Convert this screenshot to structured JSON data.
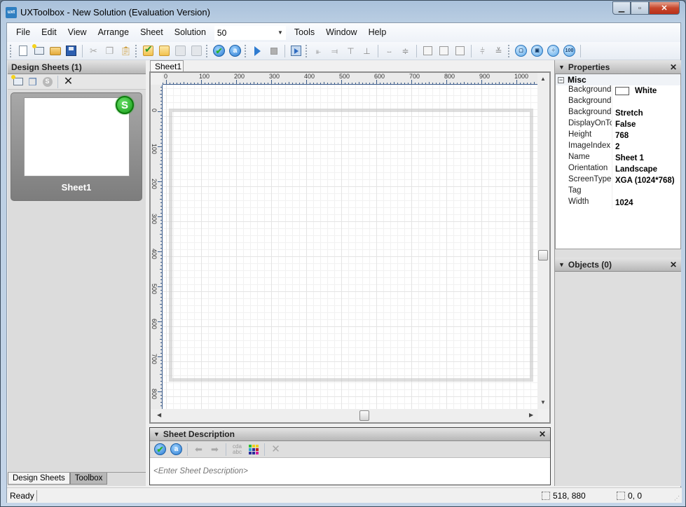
{
  "window": {
    "app_icon": "uxt",
    "title": "UXToolbox - New Solution (Evaluation Version)",
    "buttons": {
      "minimize": "minimize-icon",
      "maximize": "maximize-icon",
      "close": "close-icon"
    }
  },
  "menubar": {
    "items": [
      "File",
      "Edit",
      "View",
      "Arrange",
      "Sheet",
      "Solution"
    ],
    "zoom_value": "50",
    "items_after": [
      "Tools",
      "Window",
      "Help"
    ]
  },
  "toolbar": {
    "groups": [
      [
        "new-document",
        "new-sheet",
        "open-folder",
        "save"
      ],
      [
        "cut",
        "copy",
        "paste"
      ],
      [
        "sheet-checked",
        "sheet-blank",
        "sheet-back",
        "sheet-forward"
      ],
      [
        "validate",
        "annotate"
      ],
      [
        "run",
        "stop"
      ],
      [
        "preview"
      ],
      [
        "align-left",
        "align-right",
        "align-top",
        "align-bottom"
      ],
      [
        "center-horizontal",
        "center-vertical"
      ],
      [
        "same-size",
        "same-width",
        "same-height"
      ],
      [
        "space-horizontal",
        "space-vertical"
      ],
      [
        "fit-page",
        "zoom-region",
        "zoom-fit",
        "zoom-100"
      ]
    ],
    "zoom_100_label": "100"
  },
  "design_sheets": {
    "title": "Design Sheets (1)",
    "tools": [
      "new-sheet",
      "duplicate-sheet",
      "start-sheet",
      "delete-sheet"
    ],
    "sheets": [
      {
        "name": "Sheet1",
        "badge": "S"
      }
    ],
    "tabs": [
      "Design Sheets",
      "Toolbox"
    ],
    "active_tab": "Design Sheets"
  },
  "canvas": {
    "tab": "Sheet1",
    "hruler_labels": [
      "0",
      "100",
      "200",
      "300",
      "400",
      "500",
      "600",
      "700",
      "800",
      "900",
      "1000"
    ],
    "vruler_labels": [
      "0",
      "100",
      "200",
      "300",
      "400",
      "500",
      "600",
      "700",
      "800"
    ]
  },
  "sheet_description": {
    "title": "Sheet Description",
    "placeholder": "<Enter Sheet Description>",
    "tools": [
      "validate",
      "annotate",
      "back",
      "forward",
      "spell-check",
      "color-palette",
      "delete"
    ],
    "spell_label_top": "cda",
    "spell_label_bottom": "abc"
  },
  "properties": {
    "title": "Properties",
    "category": "Misc",
    "rows": [
      {
        "key": "BackgroundC",
        "value": "White",
        "swatch": "#ffffff"
      },
      {
        "key": "BackgroundIı",
        "value": ""
      },
      {
        "key": "BackgroundL",
        "value": "Stretch"
      },
      {
        "key": "DisplayOnTo",
        "value": "False"
      },
      {
        "key": "Height",
        "value": "768"
      },
      {
        "key": "ImageIndex",
        "value": "2"
      },
      {
        "key": "Name",
        "value": "Sheet 1"
      },
      {
        "key": "Orientation",
        "value": "Landscape"
      },
      {
        "key": "ScreenType",
        "value": "XGA (1024*768)"
      },
      {
        "key": "Tag",
        "value": ""
      },
      {
        "key": "Width",
        "value": "1024"
      }
    ]
  },
  "objects": {
    "title": "Objects (0)"
  },
  "status": {
    "text": "Ready",
    "cursor_pos": "518, 880",
    "selection_size": "0, 0"
  },
  "colors": {
    "accent_blue": "#2e7bd0",
    "badge_green": "#139a13",
    "close_red": "#c7462b"
  }
}
